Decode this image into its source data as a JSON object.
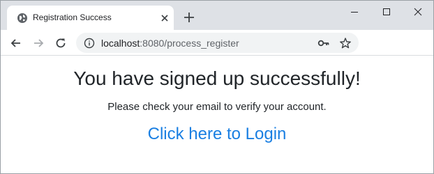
{
  "tab": {
    "title": "Registration Success",
    "favicon": "globe-icon"
  },
  "toolbar": {
    "url_host": "localhost",
    "url_path": ":8080/process_register"
  },
  "page": {
    "heading": "You have signed up successfully!",
    "message": "Please check your email to verify your account.",
    "login_link": "Click here to Login"
  },
  "colors": {
    "tabstrip": "#dee1e6",
    "link": "#1a7fe2",
    "text": "#212529"
  }
}
